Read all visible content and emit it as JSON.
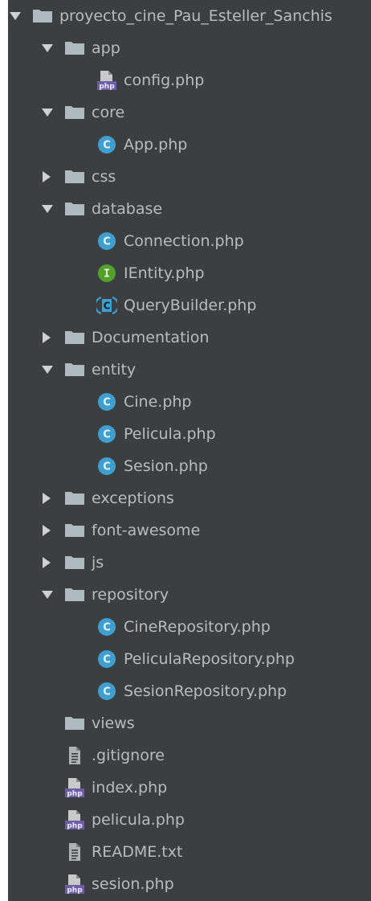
{
  "tree": {
    "items": [
      {
        "label": "proyecto_cine_Pau_Esteller_Sanchis",
        "icon": "folder-icon",
        "depth": 0,
        "expandable": true,
        "expanded": true
      },
      {
        "label": "app",
        "icon": "folder-icon",
        "depth": 1,
        "expandable": true,
        "expanded": true
      },
      {
        "label": "config.php",
        "icon": "php-file-icon",
        "depth": 2,
        "expandable": false
      },
      {
        "label": "core",
        "icon": "folder-icon",
        "depth": 1,
        "expandable": true,
        "expanded": true
      },
      {
        "label": "App.php",
        "icon": "class-icon",
        "depth": 2,
        "expandable": false
      },
      {
        "label": "css",
        "icon": "folder-icon",
        "depth": 1,
        "expandable": true,
        "expanded": false
      },
      {
        "label": "database",
        "icon": "folder-icon",
        "depth": 1,
        "expandable": true,
        "expanded": true
      },
      {
        "label": "Connection.php",
        "icon": "class-icon",
        "depth": 2,
        "expandable": false
      },
      {
        "label": "IEntity.php",
        "icon": "interface-icon",
        "depth": 2,
        "expandable": false
      },
      {
        "label": "QueryBuilder.php",
        "icon": "abstract-class-icon",
        "depth": 2,
        "expandable": false
      },
      {
        "label": "Documentation",
        "icon": "folder-icon",
        "depth": 1,
        "expandable": true,
        "expanded": false
      },
      {
        "label": "entity",
        "icon": "folder-icon",
        "depth": 1,
        "expandable": true,
        "expanded": true
      },
      {
        "label": "Cine.php",
        "icon": "class-icon",
        "depth": 2,
        "expandable": false
      },
      {
        "label": "Pelicula.php",
        "icon": "class-icon",
        "depth": 2,
        "expandable": false
      },
      {
        "label": "Sesion.php",
        "icon": "class-icon",
        "depth": 2,
        "expandable": false
      },
      {
        "label": "exceptions",
        "icon": "folder-icon",
        "depth": 1,
        "expandable": true,
        "expanded": false
      },
      {
        "label": "font-awesome",
        "icon": "folder-icon",
        "depth": 1,
        "expandable": true,
        "expanded": false
      },
      {
        "label": "js",
        "icon": "folder-icon",
        "depth": 1,
        "expandable": true,
        "expanded": false
      },
      {
        "label": "repository",
        "icon": "folder-icon",
        "depth": 1,
        "expandable": true,
        "expanded": true
      },
      {
        "label": "CineRepository.php",
        "icon": "class-icon",
        "depth": 2,
        "expandable": false
      },
      {
        "label": "PeliculaRepository.php",
        "icon": "class-icon",
        "depth": 2,
        "expandable": false
      },
      {
        "label": "SesionRepository.php",
        "icon": "class-icon",
        "depth": 2,
        "expandable": false
      },
      {
        "label": "views",
        "icon": "folder-icon",
        "depth": 1,
        "expandable": false
      },
      {
        "label": ".gitignore",
        "icon": "text-file-icon",
        "depth": 1,
        "expandable": false
      },
      {
        "label": "index.php",
        "icon": "php-file-icon",
        "depth": 1,
        "expandable": false
      },
      {
        "label": "pelicula.php",
        "icon": "php-file-icon",
        "depth": 1,
        "expandable": false
      },
      {
        "label": "README.txt",
        "icon": "text-file-icon",
        "depth": 1,
        "expandable": false
      },
      {
        "label": "sesion.php",
        "icon": "php-file-icon",
        "depth": 1,
        "expandable": false
      }
    ]
  },
  "colors": {
    "panel_background": "#3c3f41",
    "text": "#bbbbbb",
    "folder": "#aeb9c0",
    "arrow": "#d0d0d0",
    "class_badge": "#3f9fce",
    "interface_badge": "#55a02b",
    "php_badge": "#6c5fa8",
    "text_file": "#afb1b3"
  }
}
